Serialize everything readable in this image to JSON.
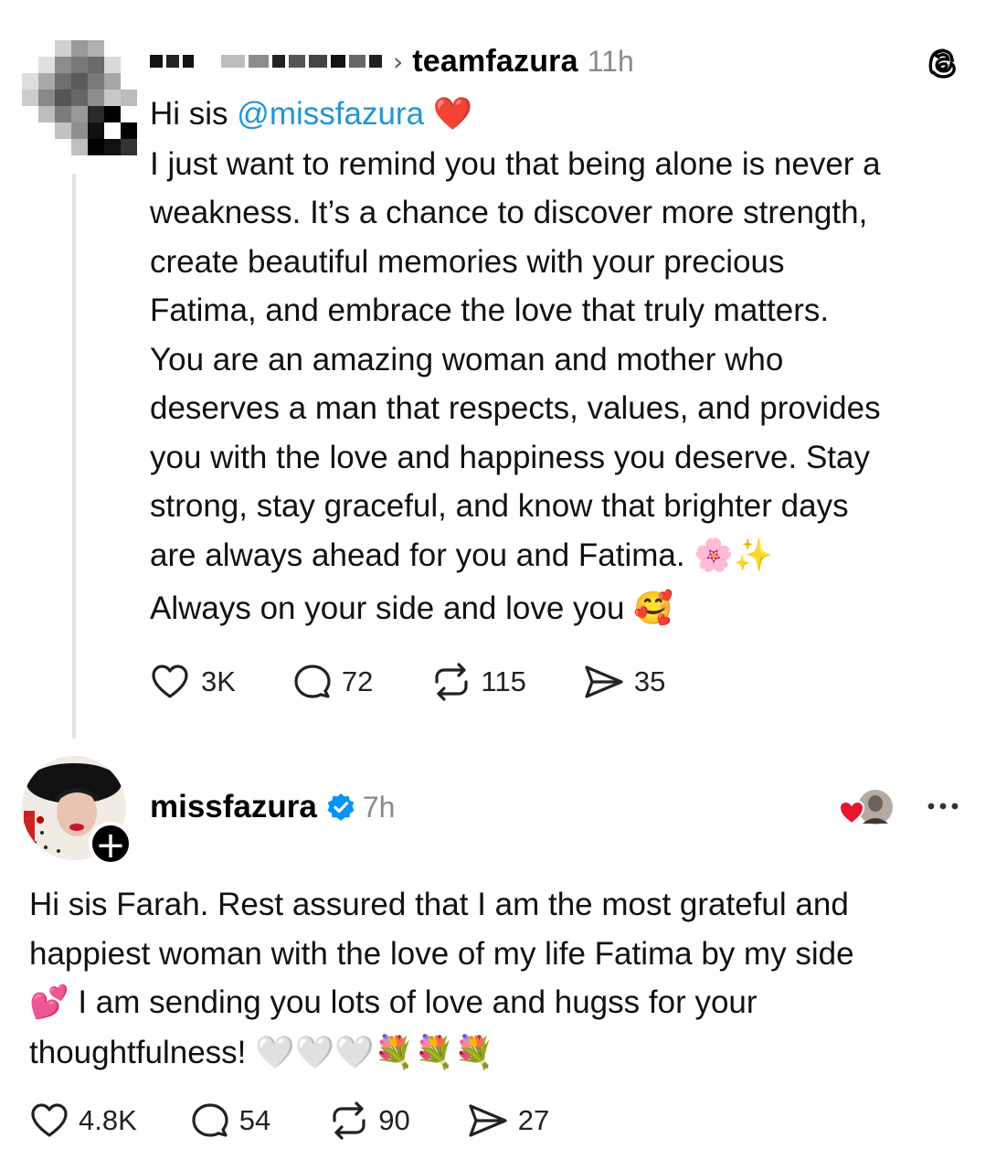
{
  "colors": {
    "mention": "#2196d6",
    "verified": "#0095f6",
    "meta_gray": "#8a8a8a"
  },
  "post1": {
    "username": "teamfazura",
    "time": "11h",
    "avatar_icon": "pixelated-avatar",
    "header_icon": "threads-logo-icon",
    "greeting": "Hi sis",
    "mention": "@missfazura",
    "greeting_emoji": "❤️",
    "body_lines": [
      "I just want to remind you that being alone is never a",
      "weakness. It’s a chance to discover more strength,",
      "create beautiful memories with your precious",
      "Fatima, and embrace the love that truly matters.",
      "You are an amazing woman and mother who",
      "deserves a man that respects, values, and provides",
      "you with the love and happiness you deserve. Stay",
      "strong, stay graceful, and know that brighter days",
      "are always ahead for you and Fatima."
    ],
    "line9_emoji": "🌸✨",
    "closing": "Always on your side and love you",
    "closing_emoji": "🥰",
    "stats": {
      "likes": "3K",
      "replies": "72",
      "reposts": "115",
      "shares": "35"
    }
  },
  "post2": {
    "username": "missfazura",
    "time": "7h",
    "verified_icon": "verified-badge-icon",
    "follow_icon": "plus-icon",
    "body_lines": [
      "Hi sis Farah. Rest assured that I am the most grateful and",
      "happiest woman with the love of my life Fatima by my side"
    ],
    "line3_emoji": "💕",
    "line3_text": "I am sending you lots of love and hugss for your",
    "line4_text": "thoughtfulness!",
    "line4_emoji": "🤍🤍🤍💐💐💐",
    "stats": {
      "likes": "4.8K",
      "replies": "54",
      "reposts": "90",
      "shares": "27"
    }
  }
}
